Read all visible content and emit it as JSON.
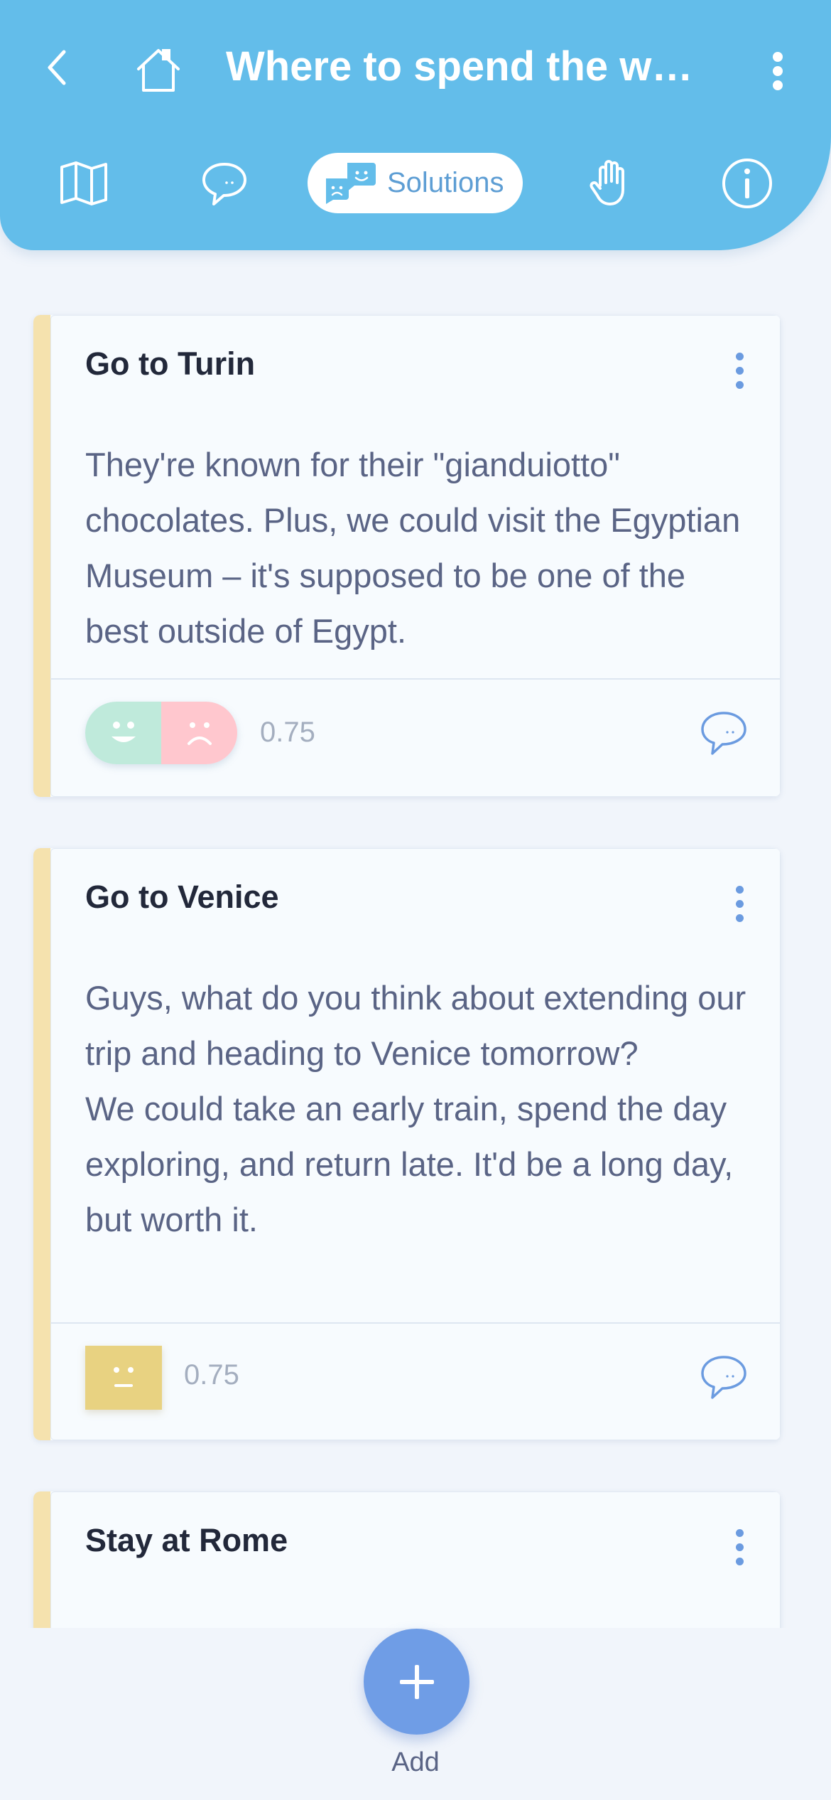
{
  "header": {
    "title": "Where to spend the weekend?",
    "back_icon": "chevron-left-icon",
    "home_icon": "home-icon",
    "menu_icon": "more-vertical-icon"
  },
  "tabs": [
    {
      "icon": "map-icon",
      "label": ""
    },
    {
      "icon": "speech-bubble-icon",
      "label": ""
    },
    {
      "icon": "solutions-faces-icon",
      "label": "Solutions",
      "active": true
    },
    {
      "icon": "hand-raise-icon",
      "label": ""
    },
    {
      "icon": "info-icon",
      "label": ""
    }
  ],
  "cards": [
    {
      "title": "Go to Turin",
      "body": "They're known for their \"gianduiotto\" chocolates. Plus, we could visit the Egyptian Museum – it's supposed to be one of the best outside of Egypt.",
      "vote": "split",
      "score": "0.75"
    },
    {
      "title": "Go to Venice",
      "body": "Guys, what do you think about extending our trip and heading to Venice tomorrow?\nWe could take an early train, spend the day exploring, and return late. It'd be a long day, but worth it.",
      "vote": "neutral",
      "score": "0.75"
    },
    {
      "title": "Stay at Rome",
      "body": ""
    }
  ],
  "fab": {
    "label": "Add",
    "icon": "plus-icon"
  },
  "colors": {
    "header": "#63bdea",
    "accent": "#6f9de6",
    "card_stripe": "#f5e2ae",
    "vote_positive": "#bfeadb",
    "vote_negative": "#ffc7ce",
    "vote_neutral": "#e8d281"
  }
}
